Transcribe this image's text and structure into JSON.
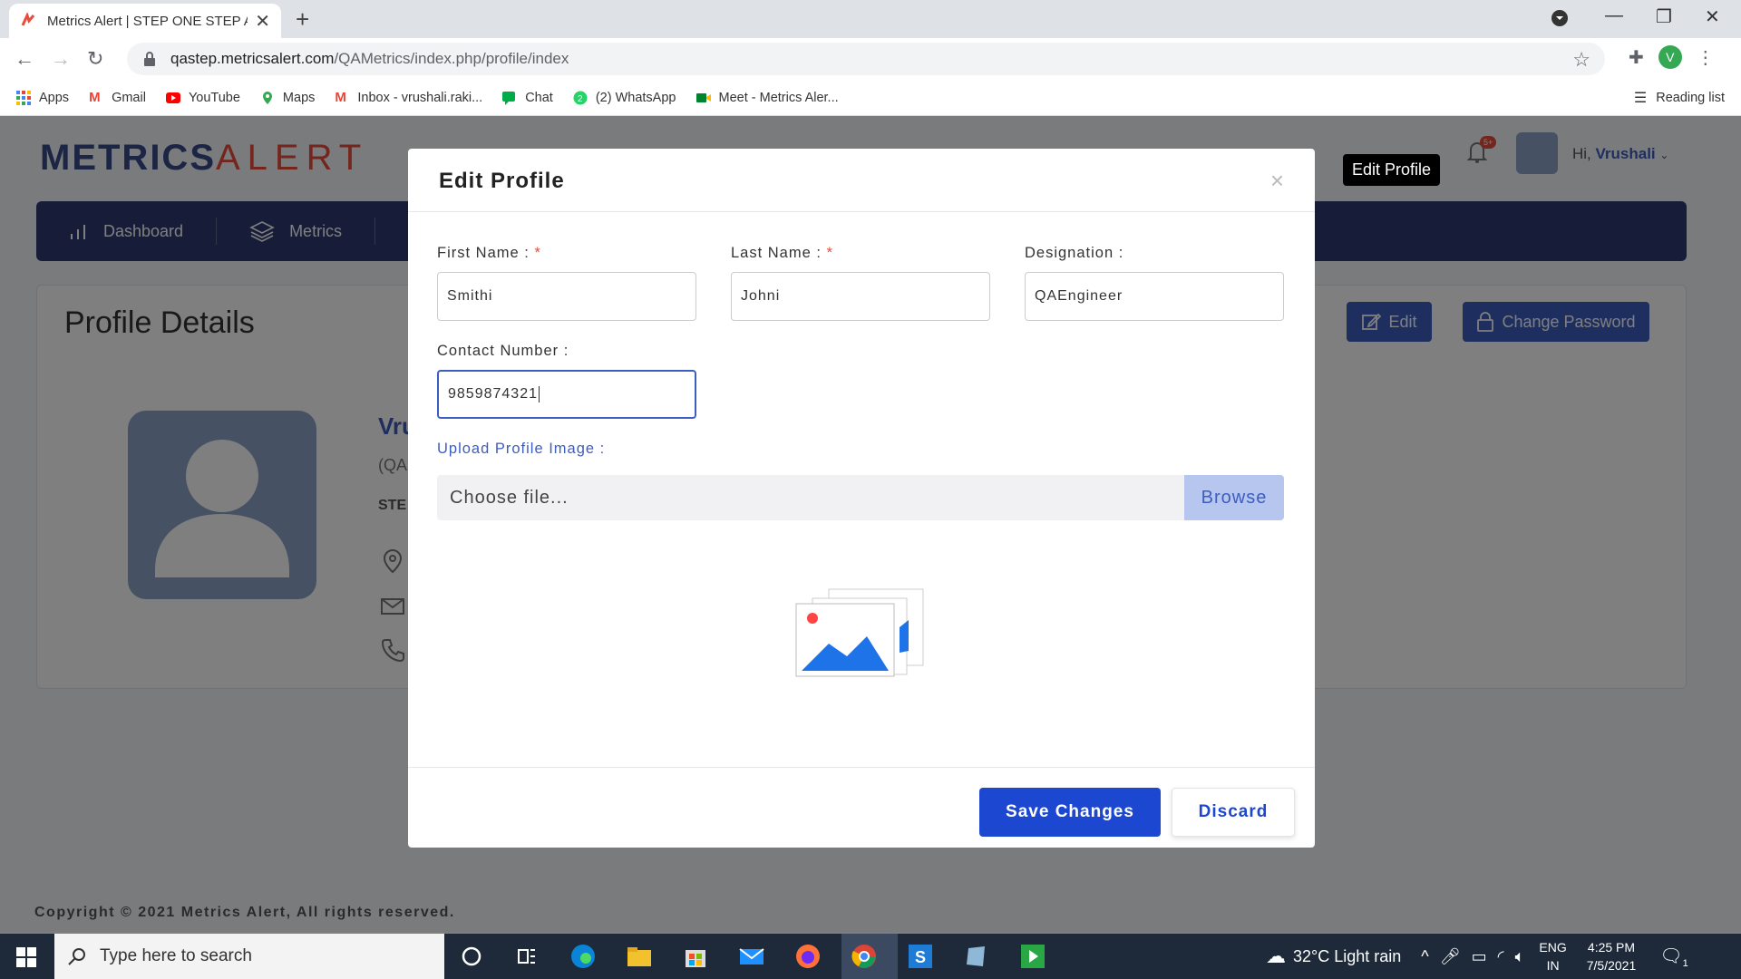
{
  "browser": {
    "tab_title": "Metrics Alert | STEP ONE STEP AH",
    "url": "qastep.metricsalert.com/QAMetrics/index.php/profile/index",
    "url_host": "qastep.metricsalert.com",
    "url_path": "/QAMetrics/index.php/profile/index",
    "profile_initial": "V",
    "bookmarks": [
      "Apps",
      "Gmail",
      "YouTube",
      "Maps",
      "Inbox - vrushali.raki...",
      "Chat",
      "(2) WhatsApp",
      "Meet - Metrics Aler..."
    ],
    "reading_list": "Reading list"
  },
  "app": {
    "logo_part1": "METRICS",
    "logo_part2": "ALERT",
    "notification_badge": "5+",
    "greeting": "Hi,",
    "user_name": "Vrushali",
    "nav": [
      "Dashboard",
      "Metrics"
    ],
    "card_title": "Profile Details",
    "profile_name_fragment": "Vru",
    "profile_designation_fragment": "(QA",
    "profile_company_fragment": "STE",
    "edit_button": "Edit",
    "change_password_button": "Change Password",
    "tooltip": "Edit Profile",
    "footer": "Copyright © 2021 Metrics Alert, All rights reserved."
  },
  "modal": {
    "title": "Edit Profile",
    "close": "×",
    "first_name_label": "First Name :",
    "last_name_label": "Last Name :",
    "designation_label": "Designation :",
    "contact_label": "Contact Number :",
    "required_mark": "*",
    "first_name_value": "Smithi",
    "last_name_value": "Johni",
    "designation_value": "QAEngineer",
    "contact_value": "9859874321",
    "upload_label": "Upload Profile Image :",
    "file_placeholder": "Choose file...",
    "browse": "Browse",
    "save": "Save Changes",
    "discard": "Discard"
  },
  "taskbar": {
    "search_placeholder": "Type here to search",
    "weather": "32°C  Light rain",
    "lang1": "ENG",
    "lang2": "IN",
    "time": "4:25 PM",
    "date": "7/5/2021",
    "notif_count": "1"
  },
  "colors": {
    "primary": "#3d5dbf",
    "navbar": "#2f3b73",
    "save": "#1b47d1",
    "danger": "#e74c3c"
  }
}
